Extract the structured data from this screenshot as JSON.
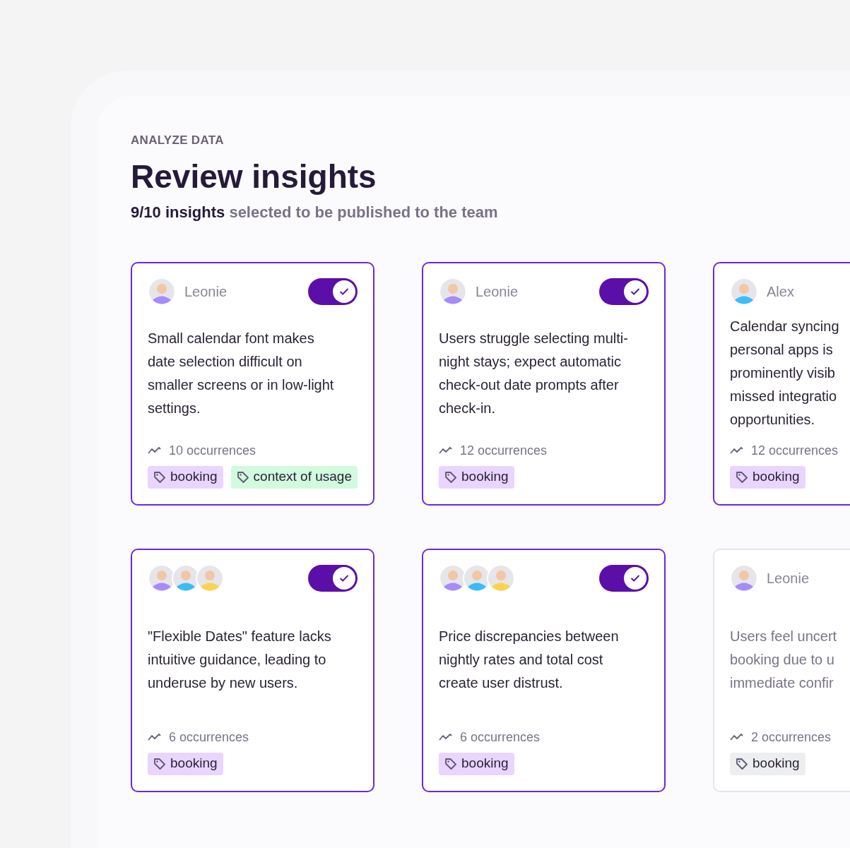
{
  "eyebrow": "ANALYZE DATA",
  "title": "Review insights",
  "subtitle": {
    "count": "9/10 insights",
    "rest": "selected to be published to the team"
  },
  "cards": [
    {
      "selected": true,
      "people": [
        {
          "color": "#a78bfa"
        }
      ],
      "author": "Leonie",
      "toggle": {
        "on": true
      },
      "text": "Small calendar font makes date selection difficult on smaller screens or in low-light settings.",
      "occurrences": "10 occurrences",
      "tags": [
        {
          "label": "booking",
          "color": "#e9d5ff"
        },
        {
          "label": "context of usage",
          "color": "#d1fadf"
        }
      ]
    },
    {
      "selected": true,
      "people": [
        {
          "color": "#a78bfa"
        }
      ],
      "author": "Leonie",
      "toggle": {
        "on": true
      },
      "text": "Users struggle selecting multi-night stays; expect automatic check-out date prompts after check-in.",
      "occurrences": "12 occurrences",
      "tags": [
        {
          "label": "booking",
          "color": "#e9d5ff"
        }
      ]
    },
    {
      "selected": true,
      "people": [
        {
          "color": "#38bdf8"
        }
      ],
      "author": "Alex",
      "lines": [
        "Calendar syncing",
        "personal apps is",
        "prominently visib",
        "missed integratio",
        "opportunities."
      ],
      "occurrences": "12 occurrences",
      "tags": [
        {
          "label": "booking",
          "color": "#e9d5ff"
        }
      ]
    },
    {
      "selected": true,
      "people": [
        {
          "color": "#a78bfa"
        },
        {
          "color": "#38bdf8"
        },
        {
          "color": "#fcd34d"
        }
      ],
      "toggle": {
        "on": true
      },
      "text": "\"Flexible Dates\" feature lacks intuitive guidance, leading to underuse by new users.",
      "occurrences": "6 occurrences",
      "tags": [
        {
          "label": "booking",
          "color": "#e9d5ff"
        }
      ]
    },
    {
      "selected": true,
      "people": [
        {
          "color": "#a78bfa"
        },
        {
          "color": "#38bdf8"
        },
        {
          "color": "#fcd34d"
        }
      ],
      "toggle": {
        "on": true
      },
      "text": "Price discrepancies between nightly rates and total cost create user distrust.",
      "occurrences": "6 occurrences",
      "tags": [
        {
          "label": "booking",
          "color": "#e9d5ff"
        }
      ]
    },
    {
      "selected": false,
      "people": [
        {
          "color": "#a78bfa"
        }
      ],
      "author": "Leonie",
      "lines": [
        "Users feel uncert",
        "booking due to u",
        "immediate confir"
      ],
      "occurrences": "2 occurrences",
      "tags": [
        {
          "label": "booking",
          "color": "#eceef0"
        }
      ]
    }
  ]
}
